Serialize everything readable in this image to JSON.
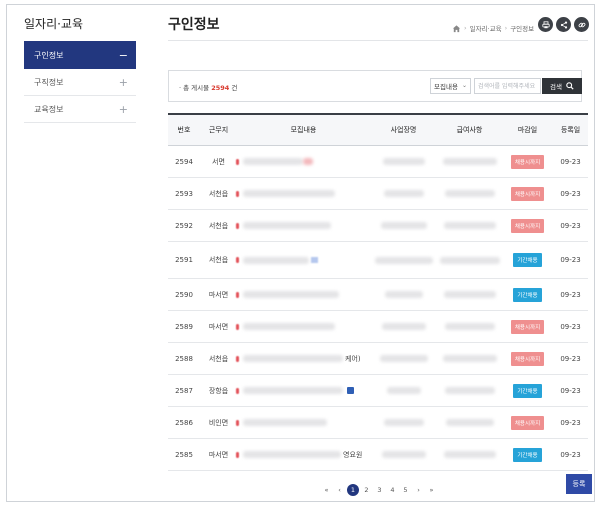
{
  "sidebar": {
    "title": "일자리·교육",
    "items": [
      {
        "label": "구인정보",
        "symbol": "−"
      },
      {
        "label": "구직정보",
        "symbol": "+"
      },
      {
        "label": "교육정보",
        "symbol": "+"
      }
    ]
  },
  "header": {
    "title": "구인정보",
    "breadcrumb": [
      "일자리·교육",
      "구인정보"
    ],
    "tools": [
      "print-icon",
      "share-icon",
      "link-icon"
    ]
  },
  "search": {
    "total_prefix": "· 총 게시물",
    "total_count": "2594",
    "total_suffix": "건",
    "select_value": "모집내용",
    "placeholder": "검색어를 입력해주세요",
    "button_label": "검색"
  },
  "table": {
    "columns": [
      "번호",
      "근무지",
      "모집내용",
      "사업장명",
      "급여사항",
      "마감일",
      "등록일"
    ],
    "rows": [
      {
        "no": "2594",
        "loc": "서면",
        "suffix": "",
        "status": "채용시까지",
        "status_type": "closed",
        "date": "09-23"
      },
      {
        "no": "2593",
        "loc": "서천읍",
        "suffix": "",
        "status": "채용시까지",
        "status_type": "closed",
        "date": "09-23"
      },
      {
        "no": "2592",
        "loc": "서천읍",
        "suffix": "",
        "status": "채용시까지",
        "status_type": "closed",
        "date": "09-23"
      },
      {
        "no": "2591",
        "loc": "서천읍",
        "suffix": "",
        "status": "기간채용",
        "status_type": "open",
        "date": "09-23"
      },
      {
        "no": "2590",
        "loc": "마서면",
        "suffix": "",
        "status": "기간채용",
        "status_type": "open",
        "date": "09-23"
      },
      {
        "no": "2589",
        "loc": "마서면",
        "suffix": "",
        "status": "채용시까지",
        "status_type": "closed",
        "date": "09-23"
      },
      {
        "no": "2588",
        "loc": "서천읍",
        "suffix": "케어)",
        "status": "채용시까지",
        "status_type": "closed",
        "date": "09-23"
      },
      {
        "no": "2587",
        "loc": "장항읍",
        "suffix": "",
        "status": "기간채용",
        "status_type": "open",
        "date": "09-23"
      },
      {
        "no": "2586",
        "loc": "비인면",
        "suffix": "",
        "status": "채용시까지",
        "status_type": "closed",
        "date": "09-23"
      },
      {
        "no": "2585",
        "loc": "마서면",
        "suffix": "영요원",
        "status": "기간채용",
        "status_type": "open",
        "date": "09-23"
      }
    ]
  },
  "pagination": {
    "first": "«",
    "prev": "‹",
    "pages": [
      "1",
      "2",
      "3",
      "4",
      "5"
    ],
    "current": "1",
    "next": "›",
    "last": "»"
  },
  "register_label": "등록",
  "colors": {
    "accent": "#22377f",
    "closed": "#ef8f8f",
    "open": "#26a3d8"
  }
}
